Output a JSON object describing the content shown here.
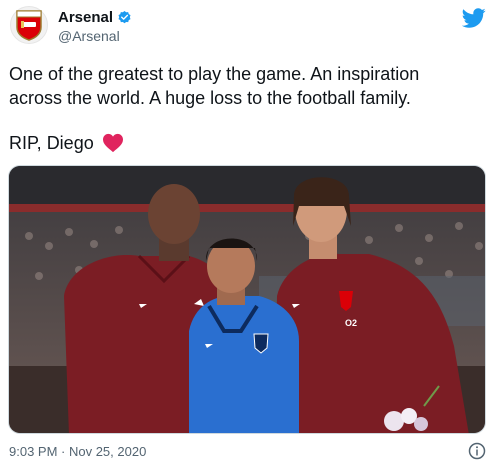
{
  "account": {
    "display_name": "Arsenal",
    "handle": "@Arsenal"
  },
  "tweet": {
    "text": "One of the greatest to play the game. An inspiration\nacross the world. A huge loss to the football family.",
    "rip": "RIP, Diego",
    "timestamp": "9:03 PM · Nov 25, 2020"
  },
  "photo": {
    "shirt_sponsor": "O2"
  },
  "icons": {
    "verified": "verified-badge-icon",
    "twitter": "twitter-bird-icon",
    "heart": "red-heart-icon",
    "info": "info-icon",
    "avatar": "arsenal-crest-icon"
  },
  "colors": {
    "brand_blue": "#1d9bf0",
    "arsenal_red": "#db0007",
    "heart_red": "#e0245e",
    "muted": "#536471"
  }
}
